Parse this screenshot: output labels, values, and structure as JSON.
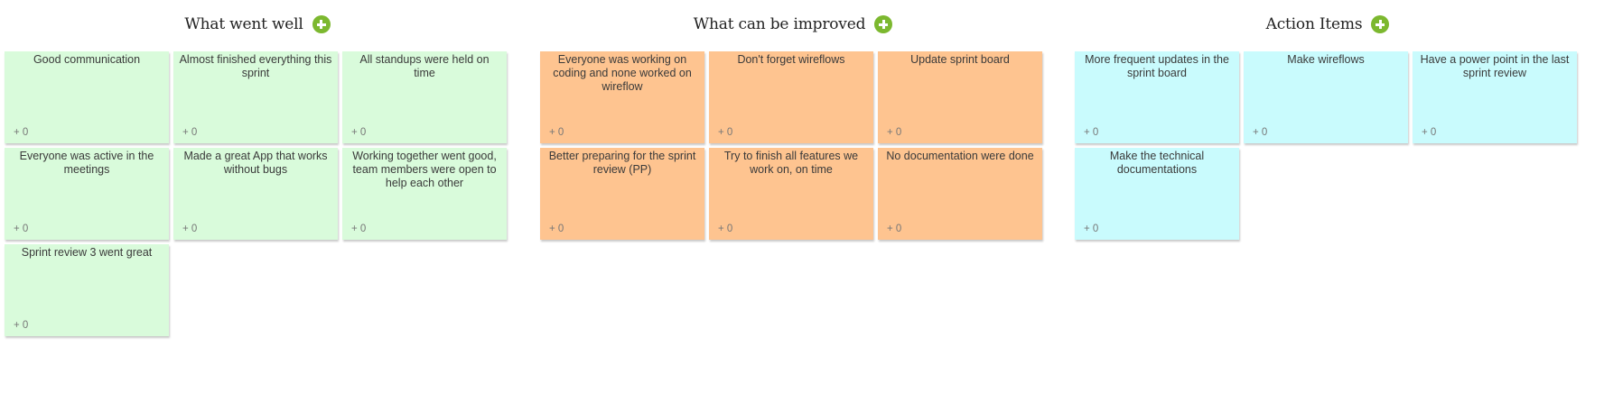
{
  "columns": [
    {
      "title": "What went well",
      "color": "#d9fbdb",
      "cards": [
        {
          "text": "Good communication",
          "votes": "+ 0"
        },
        {
          "text": "Almost finished everything this sprint",
          "votes": "+ 0"
        },
        {
          "text": "All standups were held on time",
          "votes": "+ 0"
        },
        {
          "text": "Everyone was active in the meetings",
          "votes": "+ 0"
        },
        {
          "text": "Made a great App that works without bugs",
          "votes": "+ 0"
        },
        {
          "text": "Working together went good, team members were open to help each other",
          "votes": "+ 0"
        },
        {
          "text": "Sprint review 3 went great",
          "votes": "+ 0"
        }
      ]
    },
    {
      "title": "What can be improved",
      "color": "#fec490",
      "cards": [
        {
          "text": "Everyone was working on coding and none worked on wireflow",
          "votes": "+ 0"
        },
        {
          "text": "Don't forget wireflows",
          "votes": "+ 0"
        },
        {
          "text": "Update sprint board",
          "votes": "+ 0"
        },
        {
          "text": "Better preparing for the sprint review (PP)",
          "votes": "+ 0"
        },
        {
          "text": "Try to finish all features we work on, on time",
          "votes": "+ 0"
        },
        {
          "text": "No documentation were done",
          "votes": "+ 0"
        }
      ]
    },
    {
      "title": "Action Items",
      "color": "#c9fbfd",
      "cards": [
        {
          "text": "More frequent updates in the sprint board",
          "votes": "+ 0"
        },
        {
          "text": "Make wireflows",
          "votes": "+ 0"
        },
        {
          "text": "Have a power point in the last sprint review",
          "votes": "+ 0"
        },
        {
          "text": "Make the technical documentations",
          "votes": "+ 0"
        }
      ]
    }
  ],
  "add_icon": "plus-circle-icon",
  "accent_color": "#7cb82f"
}
